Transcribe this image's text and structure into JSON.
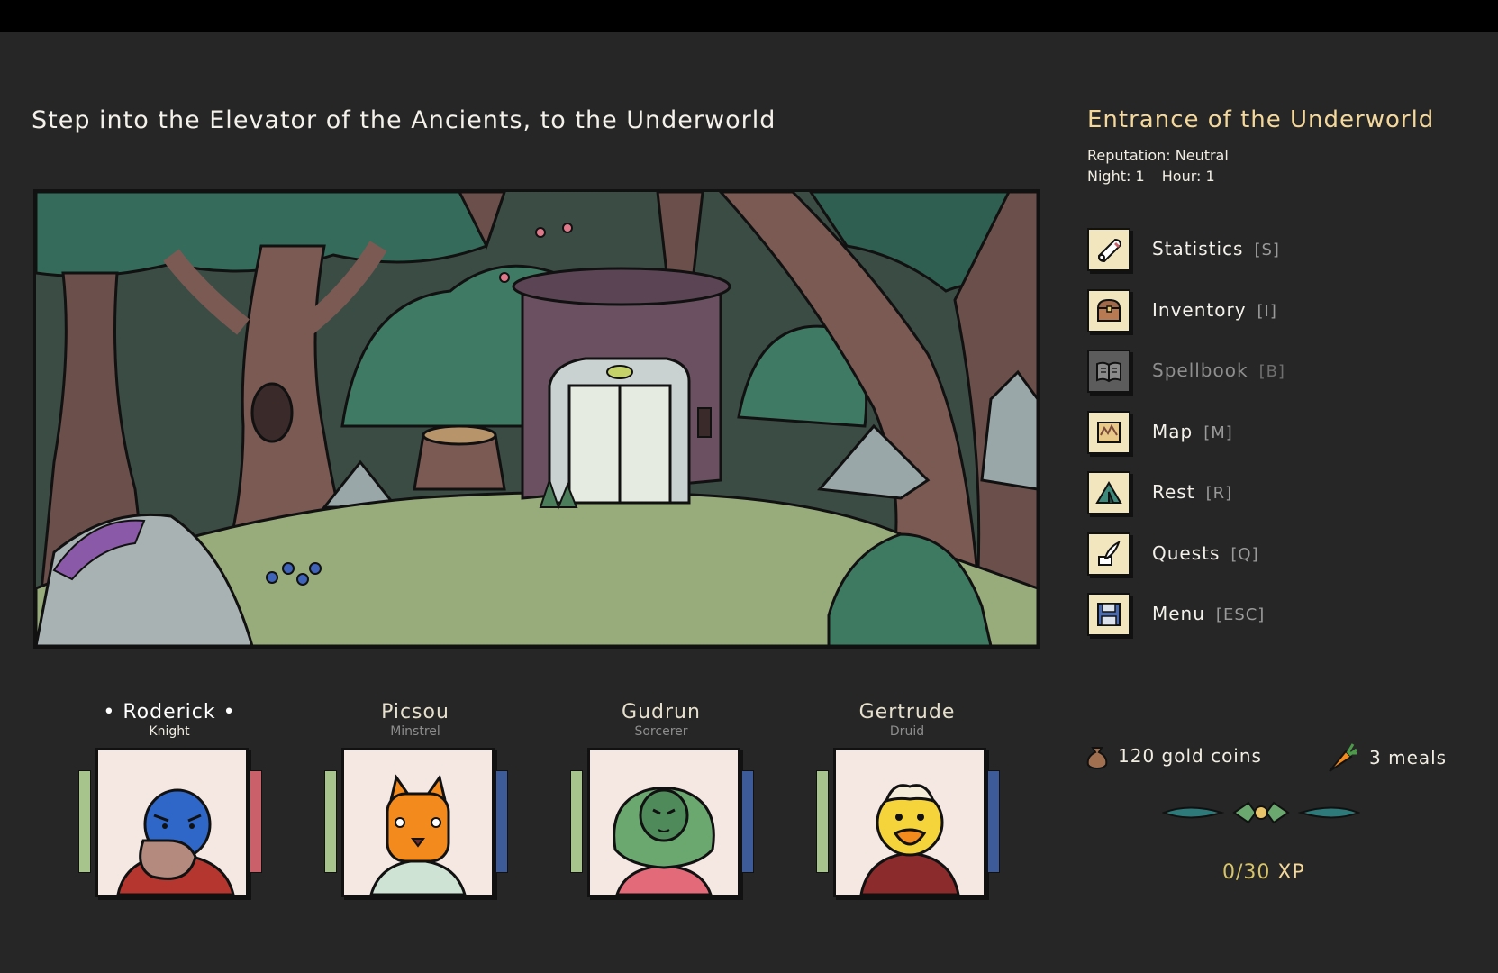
{
  "scene": {
    "title": "Step into the Elevator of the Ancients, to the Underworld"
  },
  "location": {
    "name": "Entrance of the Underworld",
    "reputation_label": "Reputation:",
    "reputation_value": "Neutral",
    "night_label": "Night:",
    "night_value": "1",
    "hour_label": "Hour:",
    "hour_value": "1"
  },
  "menu": [
    {
      "label": "Statistics",
      "key": "[S]",
      "icon": "scroll-icon",
      "enabled": true
    },
    {
      "label": "Inventory",
      "key": "[I]",
      "icon": "chest-icon",
      "enabled": true
    },
    {
      "label": "Spellbook",
      "key": "[B]",
      "icon": "book-icon",
      "enabled": false
    },
    {
      "label": "Map",
      "key": "[M]",
      "icon": "map-icon",
      "enabled": true
    },
    {
      "label": "Rest",
      "key": "[R]",
      "icon": "tent-icon",
      "enabled": true
    },
    {
      "label": "Quests",
      "key": "[Q]",
      "icon": "quill-icon",
      "enabled": true
    },
    {
      "label": "Menu",
      "key": "[ESC]",
      "icon": "floppy-disk-icon",
      "enabled": true
    }
  ],
  "party": [
    {
      "name": "Roderick",
      "class": "Knight",
      "active": true,
      "name_display": "• Roderick •",
      "right_bar_color": "#c9606a"
    },
    {
      "name": "Picsou",
      "class": "Minstrel",
      "active": false,
      "name_display": "Picsou",
      "right_bar_color": "#3d5a99"
    },
    {
      "name": "Gudrun",
      "class": "Sorcerer",
      "active": false,
      "name_display": "Gudrun",
      "right_bar_color": "#3d5a99"
    },
    {
      "name": "Gertrude",
      "class": "Druid",
      "active": false,
      "name_display": "Gertrude",
      "right_bar_color": "#3d5a99"
    }
  ],
  "resources": {
    "gold": "120 gold coins",
    "meals": "3 meals"
  },
  "xp": {
    "current": "0",
    "max": "30",
    "unit": "XP"
  },
  "colors": {
    "background": "#262626",
    "accent_title": "#f4d79a",
    "hp_bar": "#a7c48c",
    "icon_tile": "#f1e6bd"
  }
}
